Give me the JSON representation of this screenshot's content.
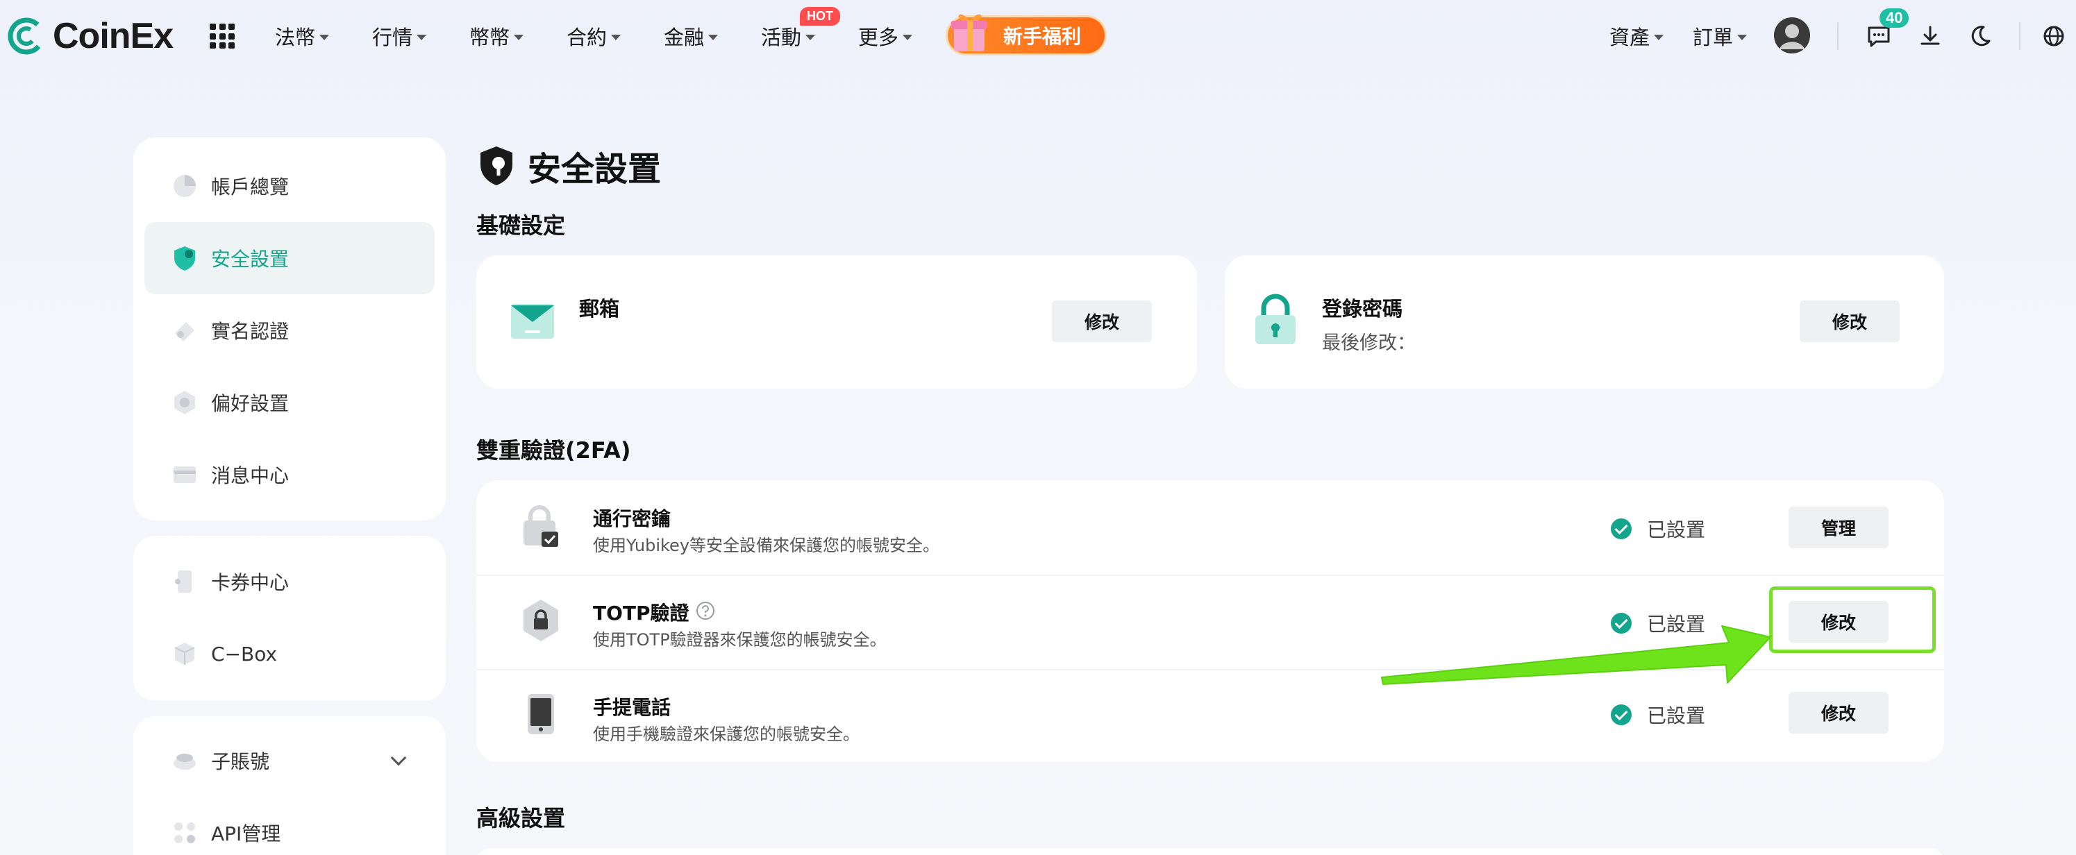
{
  "brand": {
    "name": "CoinEx",
    "accent": "#12a58c",
    "orange": "#ff7a1f"
  },
  "topnav": {
    "menu": [
      "法幣",
      "行情",
      "幣幣",
      "合約",
      "金融",
      "活動",
      "更多"
    ],
    "hot_badge": "HOT",
    "promo_label": "新手福利",
    "assets_label": "資產",
    "orders_label": "訂單",
    "message_count": "40",
    "icons": [
      "apps-grid-icon",
      "avatar-icon",
      "chat-icon",
      "download-icon",
      "moon-icon",
      "globe-icon"
    ]
  },
  "sidebar": {
    "group1": [
      {
        "label": "帳戶總覽",
        "icon": "pie-chart-icon"
      },
      {
        "label": "安全設置",
        "icon": "shield-icon",
        "active": true
      },
      {
        "label": "實名認證",
        "icon": "id-card-icon"
      },
      {
        "label": "偏好設置",
        "icon": "settings-icon"
      },
      {
        "label": "消息中心",
        "icon": "inbox-icon"
      }
    ],
    "group2": [
      {
        "label": "卡券中心",
        "icon": "coupon-icon"
      },
      {
        "label": "C−Box",
        "icon": "box-icon"
      }
    ],
    "group3": [
      {
        "label": "子賬號",
        "icon": "subaccount-icon"
      },
      {
        "label": "API管理",
        "icon": "api-icon"
      }
    ]
  },
  "main": {
    "page_title": "安全設置",
    "basic_title": "基礎設定",
    "email": {
      "title": "郵箱",
      "button": "修改"
    },
    "password": {
      "title": "登錄密碼",
      "subtitle": "最後修改：",
      "button": "修改"
    },
    "twofa_title": "雙重驗證(2FA)",
    "rows": [
      {
        "title": "通行密鑰",
        "desc": "使用Yubikey等安全設備來保護您的帳號安全。",
        "status": "已設置",
        "button": "管理"
      },
      {
        "title": "TOTP驗證",
        "desc": "使用TOTP驗證器來保護您的帳號安全。",
        "status": "已設置",
        "button": "修改"
      },
      {
        "title": "手提電話",
        "desc": "使用手機驗證來保護您的帳號安全。",
        "status": "已設置",
        "button": "修改"
      }
    ],
    "advanced_title": "高級設置"
  }
}
